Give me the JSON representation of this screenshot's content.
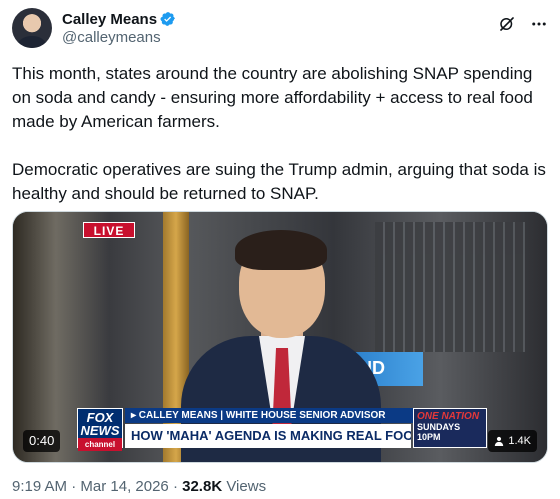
{
  "author": {
    "display_name": "Calley Means",
    "handle": "@calleymeans",
    "verified": true,
    "verified_color": "#1d9bf0"
  },
  "tweet": {
    "paragraphs": [
      "This month, states around the country are abolishing SNAP spending on soda and candy - ensuring more affordability + access to real food made by American farmers.",
      "Democratic operatives are suing the Trump admin, arguing that soda is healthy and should be returned to SNAP."
    ]
  },
  "video": {
    "live_label": "LIVE",
    "background_sign": "ND",
    "logo_line1": "FOX",
    "logo_line2": "NEWS",
    "logo_line3": "channel",
    "name_bar": "▸ CALLEY MEANS | WHITE HOUSE SENIOR ADVISOR",
    "headline": "HOW 'MAHA' AGENDA IS MAKING REAL FOOD AFFORDABLE",
    "promo_title": "ONE NATION",
    "promo_time": "SUNDAYS 10PM",
    "duration": "0:40",
    "view_badge": "1.4K"
  },
  "meta": {
    "time": "9:19 AM",
    "date": "Mar 14, 2026",
    "separator": "·",
    "views_count": "32.8K",
    "views_label": "Views"
  },
  "icons": {
    "verified": "verified-badge-icon",
    "grok": "grok-icon",
    "more": "more-icon",
    "person": "person-icon"
  }
}
